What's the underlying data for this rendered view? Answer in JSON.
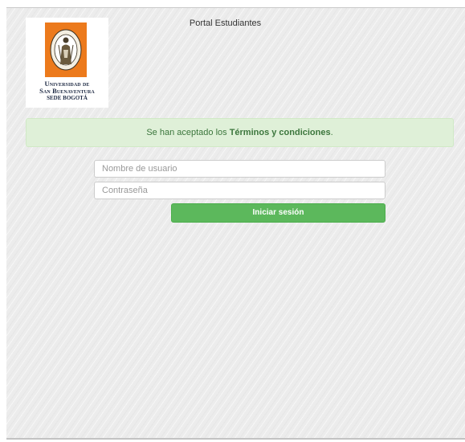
{
  "header": {
    "title": "Portal Estudiantes"
  },
  "logo": {
    "line1": "Universidad de",
    "line2": "San Buenaventura",
    "line3": "SEDE BOGOTÁ"
  },
  "alert": {
    "prefix": "Se han aceptado los ",
    "link_text": "Términos y condiciones",
    "suffix": "."
  },
  "login_form": {
    "username_placeholder": "Nombre de usuario",
    "username_value": "",
    "password_placeholder": "Contraseña",
    "password_value": "",
    "submit_label": "Iniciar sesión"
  },
  "colors": {
    "alert_background": "#dff0d8",
    "alert_text": "#3c763d",
    "button_background": "#5cb85c",
    "seal_orange": "#ec7a1c"
  }
}
